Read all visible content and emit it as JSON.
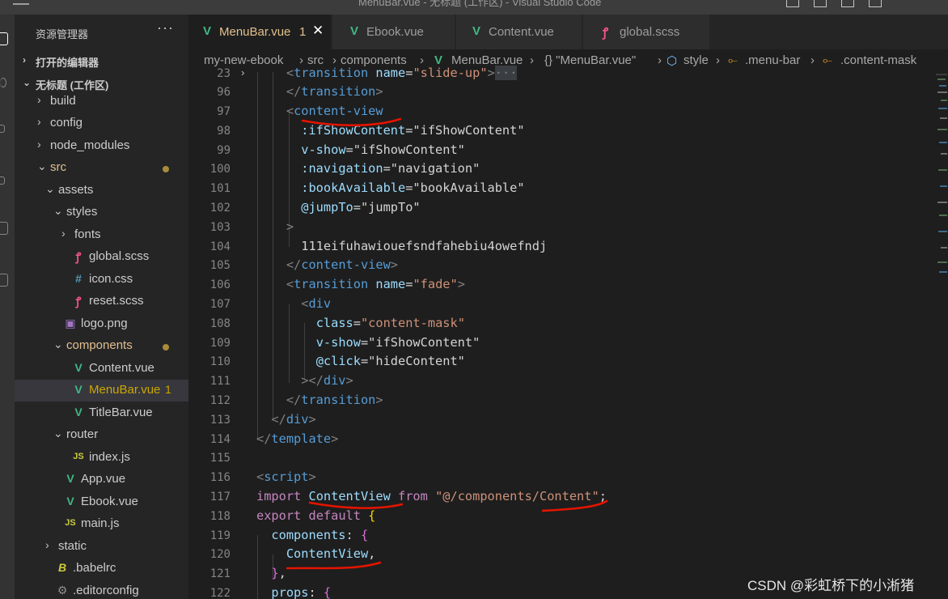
{
  "window": {
    "title": "MenuBar.vue - 无标题 (工作区) - Visual Studio Code"
  },
  "sidebar": {
    "title": "资源管理器",
    "more": "···",
    "open_editors": "打开的编辑器",
    "workspace": "无标题 (工作区)",
    "tree": [
      {
        "label": "build",
        "kind": "folder",
        "chev": "›"
      },
      {
        "label": "config",
        "kind": "folder",
        "chev": "›"
      },
      {
        "label": "node_modules",
        "kind": "folder",
        "chev": "›"
      },
      {
        "label": "src",
        "kind": "folder-open",
        "chev": "⌄"
      },
      {
        "label": "assets",
        "kind": "folder-open",
        "chev": "⌄"
      },
      {
        "label": "styles",
        "kind": "folder-open",
        "chev": "⌄"
      },
      {
        "label": "fonts",
        "kind": "folder",
        "chev": "›"
      },
      {
        "label": "global.scss",
        "kind": "scss",
        "icon": "ꝭ"
      },
      {
        "label": "icon.css",
        "kind": "css",
        "icon": "#"
      },
      {
        "label": "reset.scss",
        "kind": "scss",
        "icon": "ꝭ"
      },
      {
        "label": "logo.png",
        "kind": "png",
        "icon": "▣"
      },
      {
        "label": "components",
        "kind": "folder-open",
        "chev": "⌄"
      },
      {
        "label": "Content.vue",
        "kind": "vue",
        "icon": "V"
      },
      {
        "label": "MenuBar.vue",
        "kind": "vue",
        "icon": "V",
        "badge": "1"
      },
      {
        "label": "TitleBar.vue",
        "kind": "vue",
        "icon": "V"
      },
      {
        "label": "router",
        "kind": "folder-open",
        "chev": "⌄"
      },
      {
        "label": "index.js",
        "kind": "js",
        "icon": "JS"
      },
      {
        "label": "App.vue",
        "kind": "vue",
        "icon": "V"
      },
      {
        "label": "Ebook.vue",
        "kind": "vue",
        "icon": "V"
      },
      {
        "label": "main.js",
        "kind": "js",
        "icon": "JS"
      },
      {
        "label": "static",
        "kind": "folder",
        "chev": "›"
      },
      {
        "label": ".babelrc",
        "kind": "babel",
        "icon": "B"
      },
      {
        "label": ".editorconfig",
        "kind": "gear",
        "icon": "⚙"
      }
    ]
  },
  "tabs": [
    {
      "label": "MenuBar.vue",
      "badge": "1",
      "close": "✕",
      "icon": "V"
    },
    {
      "label": "Ebook.vue",
      "icon": "V"
    },
    {
      "label": "Content.vue",
      "icon": "V"
    },
    {
      "label": "global.scss",
      "icon": "ꝭ"
    }
  ],
  "breadcrumb": {
    "items": [
      "my-new-ebook",
      "src",
      "components",
      "MenuBar.vue",
      "{} \"MenuBar.vue\"",
      "style",
      ".menu-bar",
      ".content-mask"
    ],
    "sep": "›"
  },
  "editor": {
    "line_numbers": [
      "23",
      "96",
      "97",
      "98",
      "99",
      "100",
      "101",
      "102",
      "103",
      "104",
      "105",
      "106",
      "107",
      "108",
      "109",
      "110",
      "111",
      "112",
      "113",
      "114",
      "115",
      "116",
      "117",
      "118",
      "119",
      "120",
      "121",
      "122"
    ],
    "fold_marker": "›"
  },
  "watermark": "CSDN @彩虹桥下的小淅猪",
  "colors": {
    "accent_modified": "#e2c08d",
    "vue_green": "#41b883",
    "annotation_red": "#e51400"
  }
}
